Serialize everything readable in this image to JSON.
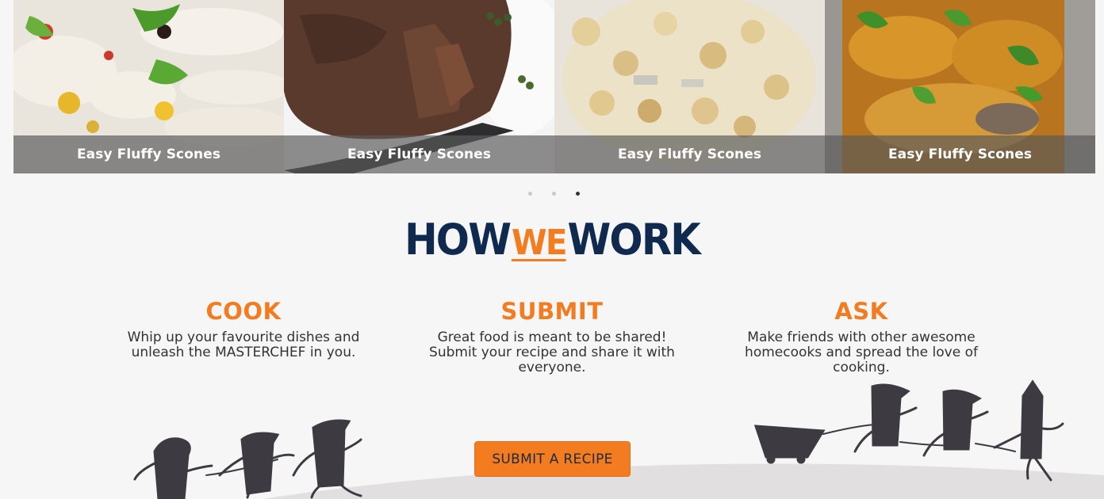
{
  "carousel": {
    "slides": [
      {
        "caption": "Easy Fluffy Scones"
      },
      {
        "caption": "Easy Fluffy Scones"
      },
      {
        "caption": "Easy Fluffy Scones"
      },
      {
        "caption": "Easy Fluffy Scones"
      }
    ],
    "dots_count": 3,
    "active_dot": 3
  },
  "how_we_work": {
    "title_how": "HOW",
    "title_we": "WE",
    "title_work": "WORK"
  },
  "steps": [
    {
      "heading": "COOK",
      "text": "Whip up your favourite dishes and unleash the MASTERCHEF in you."
    },
    {
      "heading": "SUBMIT",
      "text": "Great food is meant to be shared! Submit your recipe and share it with everyone."
    },
    {
      "heading": "ASK",
      "text": "Make friends with other awesome homecooks and spread the love of cooking."
    }
  ],
  "cta": {
    "label": "SUBMIT A RECIPE"
  },
  "colors": {
    "accent": "#f47c20",
    "navy": "#0f2a4e",
    "figure": "#3d3a42"
  }
}
